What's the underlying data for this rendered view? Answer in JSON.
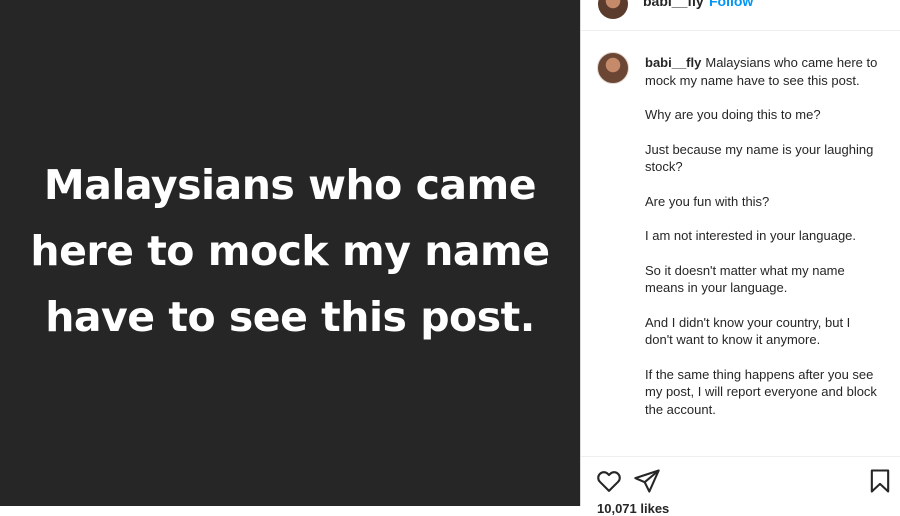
{
  "post": {
    "image_text": "Malaysians who came here to mock my name have to see this post."
  },
  "header": {
    "username": "babi__fly",
    "follow_label": "Follow"
  },
  "caption": {
    "username": "babi__fly",
    "first_line": "Malaysians who came here to mock my name have to see this post.",
    "paragraphs": [
      "Why are you doing this to me?",
      "Just because my name is your laughing stock?",
      "Are you fun with this?",
      "I am not interested in your language.",
      "So it doesn't matter what my name means in your language.",
      "And I didn't know your country, but I don't want to know it anymore.",
      "If the same thing happens after you see my post, I will report everyone and block the account."
    ]
  },
  "actions": {
    "likes_text": "10,071 likes",
    "icons": [
      "heart-icon",
      "paper-plane-icon",
      "bookmark-icon"
    ]
  }
}
